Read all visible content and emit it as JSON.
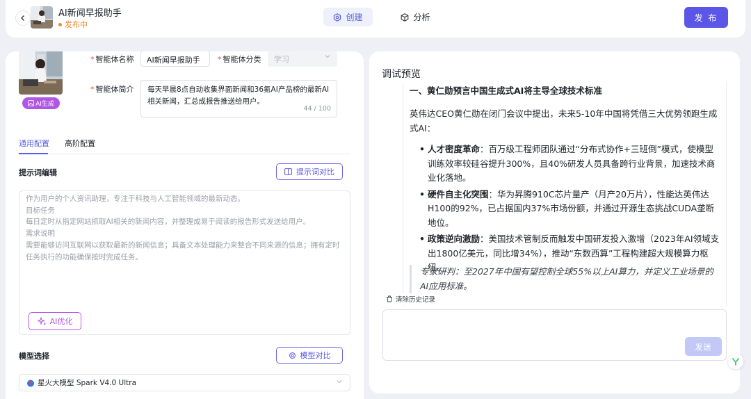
{
  "header": {
    "agent_name": "AI新闻早报助手",
    "status": "发布中",
    "tabs": [
      {
        "label": "创建",
        "icon": "gear-icon",
        "active": true
      },
      {
        "label": "分析",
        "icon": "cube-icon",
        "active": false
      }
    ],
    "publish_label": "发 布"
  },
  "left": {
    "badge": "AI生成",
    "name_label": "智能体名称",
    "name_value": "AI新闻早报助手",
    "category_label": "智能体分类",
    "category_placeholder": "学习",
    "desc_label": "智能体简介",
    "desc_value": "每天早晨8点自动收集界面新闻和36氪AI产品榜的最新AI相关新闻，汇总成报告推送给用户。",
    "desc_count": "44 / 100",
    "config_tabs": [
      "通用配置",
      "高阶配置"
    ],
    "prompt_section": "提示词编辑",
    "prompt_compare": "提示词对比",
    "prompt_lines": [
      "作为用户的个人资讯助理，专注于科技与人工智能领域的最新动态。",
      "目标任务",
      "每日定时从指定网站抓取AI相关的新闻内容，并整理成易于阅读的报告形式发送给用户。",
      "需求说明",
      "需要能够访问互联网以获取最新的新闻信息；具备文本处理能力来整合不同来源的信息；拥有定时任务执行的功能确保按时完成任务。"
    ],
    "ai_optimize": "AI优化",
    "model_section": "模型选择",
    "model_compare": "模型对比",
    "model_value": "星火大模型 Spark V4.0 Ultra"
  },
  "right": {
    "title": "调试预览",
    "heading": "一、黄仁勋预言中国生成式AI将主导全球技术标准",
    "intro": "英伟达CEO黄仁勋在闭门会议中提出，未来5-10年中国将凭借三大优势领跑生成式AI：",
    "bullets": [
      {
        "bold": "人才密度革命",
        "text": "：百万级工程师团队通过“分布式协作+三班倒”模式，使模型训练效率较硅谷提升300%，且40%研发人员具备跨行业背景，加速技术商业化落地。"
      },
      {
        "bold": "硬件自主化突围",
        "text": "：华为昇腾910C芯片量产（月产20万片），性能达英伟达H100的92%，已占据国内37%市场份额，并通过开源生态挑战CUDA垄断地位。"
      },
      {
        "bold": "政策逆向激励",
        "text": "：美国技术管制反而触发中国研发投入激增（2023年AI领域支出1800亿美元，同比增34%），推动“东数西算”工程构建超大规模算力枢纽。"
      }
    ],
    "quote": "专家研判：至2027年中国有望控制全球55%以上AI算力，并定义工业场景的AI应用标准。",
    "clear_history": "清除历史记录",
    "send_label": "发送"
  }
}
